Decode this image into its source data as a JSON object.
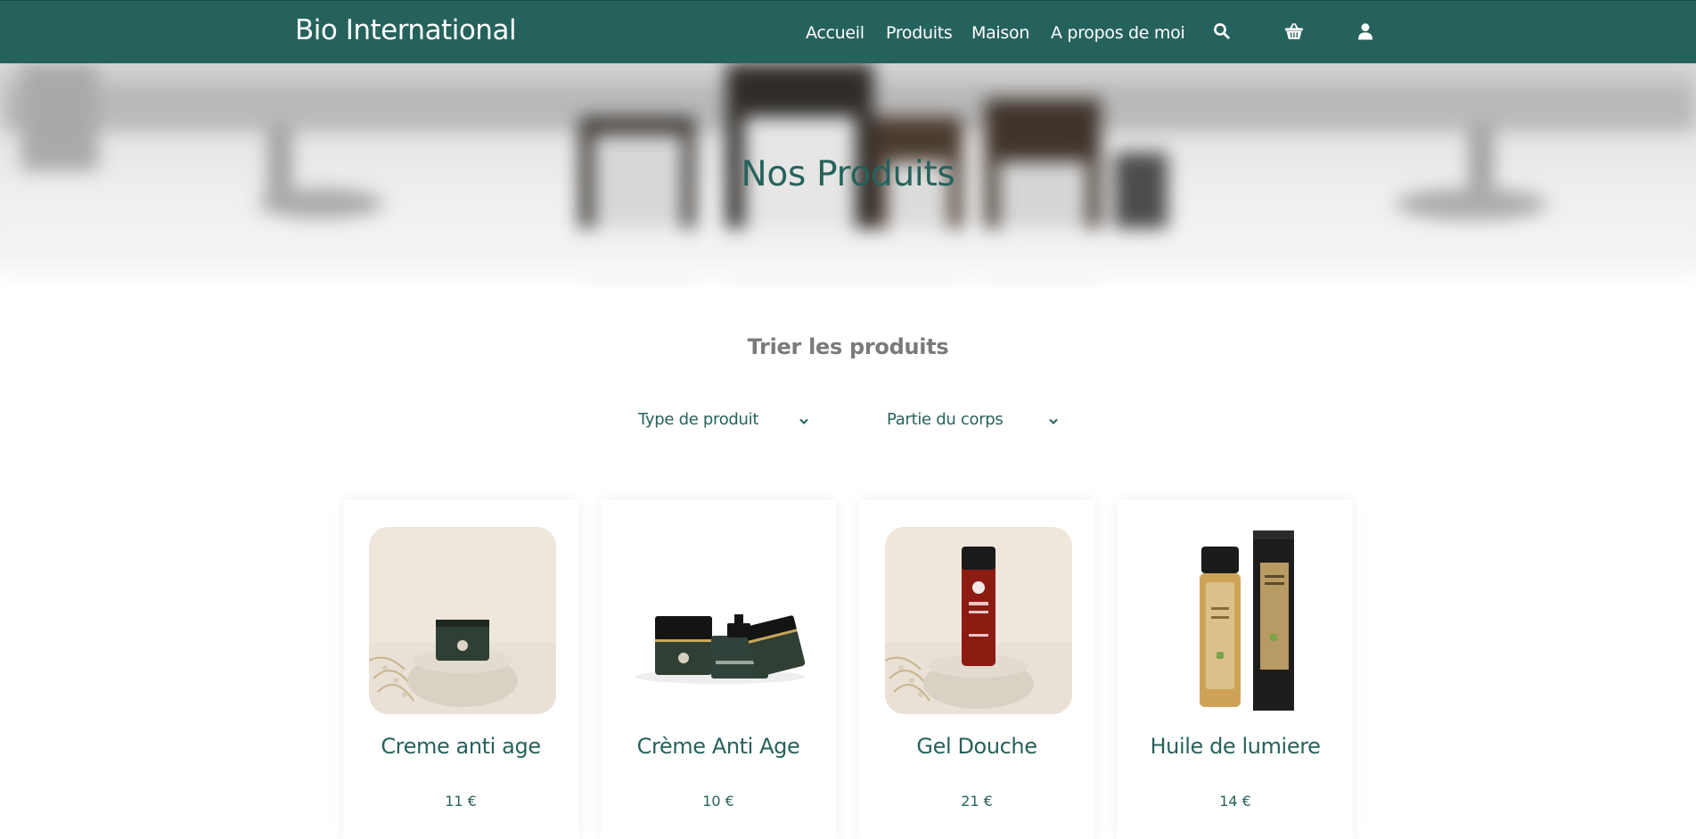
{
  "header": {
    "brand": "Bio International",
    "nav": [
      {
        "label": "Accueil"
      },
      {
        "label": "Produits"
      },
      {
        "label": "Maison"
      },
      {
        "label": "A propos de moi"
      }
    ],
    "icons": [
      "search-icon",
      "basket-icon",
      "user-icon"
    ]
  },
  "hero": {
    "title": "Nos Produits"
  },
  "sort": {
    "title": "Trier les produits",
    "filters": [
      {
        "label": "Type de produit",
        "icon": "chevron-down-icon"
      },
      {
        "label": "Partie du corps",
        "icon": "chevron-down-icon"
      }
    ]
  },
  "products": [
    {
      "name": "Creme anti age",
      "price": "11 €"
    },
    {
      "name": "Crème Anti Age",
      "price": "10 €"
    },
    {
      "name": "Gel Douche",
      "price": "21 €"
    },
    {
      "name": "Huile de lumiere",
      "price": "14 €"
    }
  ],
  "colors": {
    "brand": "#26625c",
    "header_bg": "#26625c",
    "muted_text": "#7a7a7a",
    "background": "#ffffff"
  }
}
